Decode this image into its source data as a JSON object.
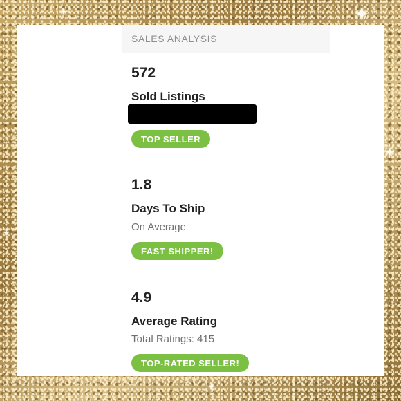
{
  "header": {
    "title": "SALES ANALYSIS"
  },
  "metrics": [
    {
      "value": "572",
      "label": "Sold Listings",
      "sub": "",
      "badge": "TOP SELLER",
      "redacted": true
    },
    {
      "value": "1.8",
      "label": "Days To Ship",
      "sub": "On Average",
      "badge": "FAST SHIPPER!",
      "redacted": false
    },
    {
      "value": "4.9",
      "label": "Average Rating",
      "sub": "Total Ratings: 415",
      "badge": "TOP-RATED SELLER!",
      "redacted": false
    }
  ],
  "colors": {
    "badge": "#7bc043",
    "header_bg": "#f6f6f6",
    "frame": "#b99a5b",
    "redaction": "#000000"
  },
  "icons": [
    "sparkle-icon"
  ]
}
